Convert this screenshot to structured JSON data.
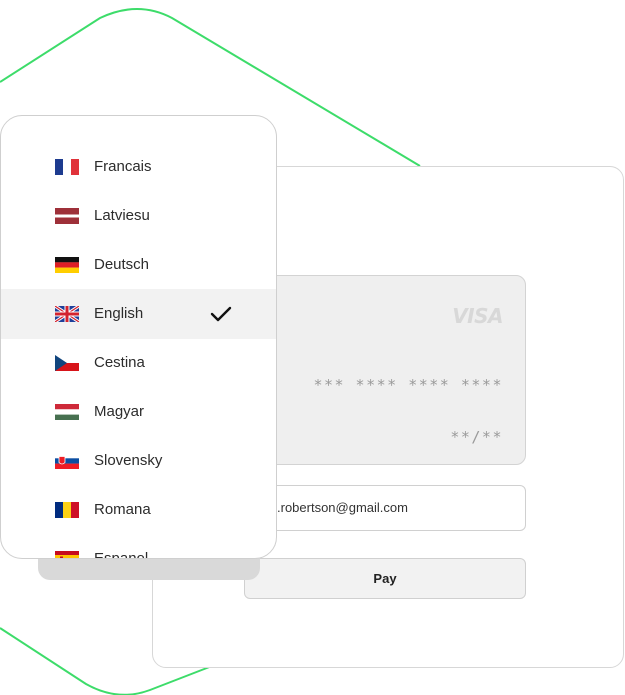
{
  "languages": [
    {
      "label": "Francais",
      "flag": "flag-france-icon",
      "selected": false
    },
    {
      "label": "Latviesu",
      "flag": "flag-latvia-icon",
      "selected": false
    },
    {
      "label": "Deutsch",
      "flag": "flag-germany-icon",
      "selected": false
    },
    {
      "label": "English",
      "flag": "flag-uk-icon",
      "selected": true
    },
    {
      "label": "Cestina",
      "flag": "flag-czech-icon",
      "selected": false
    },
    {
      "label": "Magyar",
      "flag": "flag-hungary-icon",
      "selected": false
    },
    {
      "label": "Slovensky",
      "flag": "flag-slovakia-icon",
      "selected": false
    },
    {
      "label": "Romana",
      "flag": "flag-romania-icon",
      "selected": false
    },
    {
      "label": "Espanol",
      "flag": "flag-spain-icon",
      "selected": false
    }
  ],
  "card": {
    "brand": "VISA",
    "number": "*** **** **** ****",
    "expiry": "**/**"
  },
  "email": {
    "value": ".robertson@gmail.com"
  },
  "pay_button": {
    "label": "Pay"
  },
  "colors": {
    "accent_outline": "#3ddc6a"
  }
}
